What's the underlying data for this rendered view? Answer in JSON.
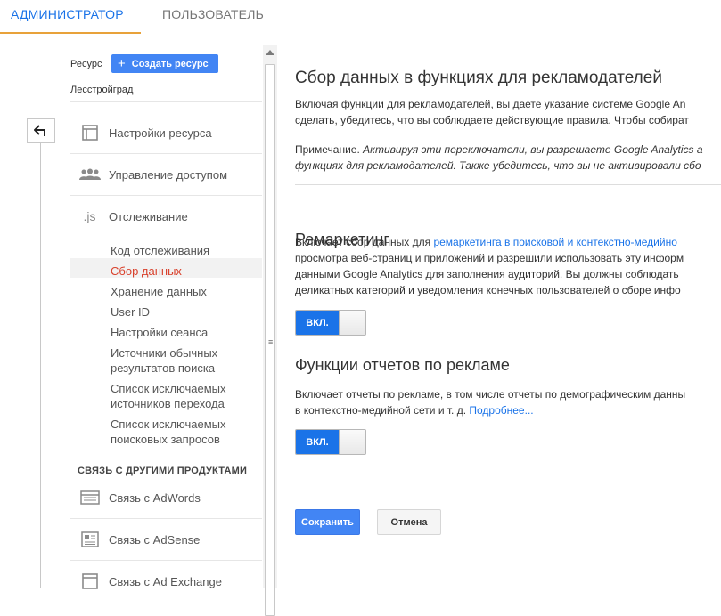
{
  "tabs": [
    {
      "label": "АДМИНИСТРАТОР",
      "active": true
    },
    {
      "label": "ПОЛЬЗОВАТЕЛЬ",
      "active": false
    }
  ],
  "sidebar": {
    "resource_label": "Ресурс",
    "create_button": "Создать ресурс",
    "resource_name": "Лесстройград",
    "items": [
      {
        "label": "Настройки ресурса",
        "icon": "window-icon"
      },
      {
        "label": "Управление доступом",
        "icon": "people-icon"
      },
      {
        "label": "Отслеживание",
        "icon": "js-icon",
        "icon_text": ".js"
      }
    ],
    "subitems": [
      {
        "label": "Код отслеживания"
      },
      {
        "label": "Сбор данных",
        "active": true
      },
      {
        "label": "Хранение данных"
      },
      {
        "label": "User ID"
      },
      {
        "label": "Настройки сеанса"
      },
      {
        "label": "Источники обычных",
        "label2": "результатов поиска"
      },
      {
        "label": "Список исключаемых",
        "label2": "источников перехода"
      },
      {
        "label": "Список исключаемых",
        "label2": "поисковых запросов"
      }
    ],
    "section_header": "СВЯЗЬ С ДРУГИМИ ПРОДУКТАМИ",
    "links": [
      {
        "label": "Связь с AdWords",
        "icon": "adwords-icon"
      },
      {
        "label": "Связь с AdSense",
        "icon": "adsense-icon"
      },
      {
        "label": "Связь с Ad Exchange",
        "icon": "adexchange-icon"
      }
    ]
  },
  "main": {
    "title": "Сбор данных в функциях для рекламодателей",
    "intro_line1": "Включая функции для рекламодателей, вы даете указание системе Google An",
    "intro_line2": "сделать, убедитесь, что вы соблюдаете действующие правила. Чтобы собират",
    "note_label": "Примечание.",
    "note_line1": "Активируя эти переключатели, вы разрешаете Google Analytics а",
    "note_line2": "функциях для рекламодателей. Также убедитесь, что вы не активировали сбо",
    "remarketing": {
      "title": "Ремаркетинг",
      "line1_prefix": "Включает сбор данных для ",
      "line1_link": "ремаркетинга в поисковой и контекстно-медийно",
      "line2": "просмотра веб-страниц и приложений и разрешили использовать эту информ",
      "line3": "данными Google Analytics для заполнения аудиторий. Вы должны соблюдать",
      "line4": "деликатных категорий и уведомления конечных пользователей о сборе инфо",
      "toggle_label": "ВКЛ."
    },
    "reports": {
      "title": "Функции отчетов по рекламе",
      "line1": "Включает отчеты по рекламе, в том числе отчеты по демографическим данны",
      "line2_prefix": "в контекстно-медийной сети и т. д. ",
      "line2_link": "Подробнее...",
      "toggle_label": "ВКЛ."
    },
    "save_button": "Сохранить",
    "cancel_button": "Отмена"
  },
  "colors": {
    "accent": "#1a73e8",
    "active_tab_underline": "#e8a23a",
    "active_nav": "#d9412c",
    "button_blue": "#4285f4"
  }
}
